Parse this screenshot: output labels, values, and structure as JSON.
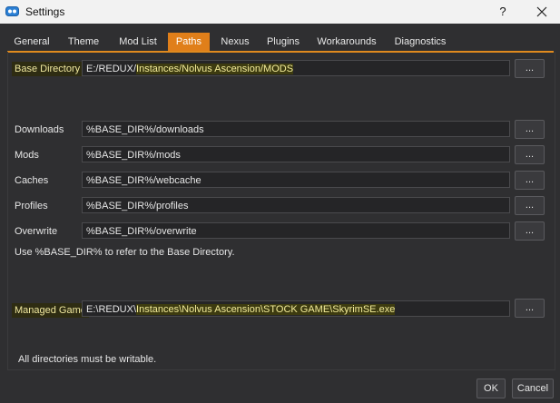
{
  "window": {
    "title": "Settings",
    "help_label": "?",
    "app_icon": "mo2-icon",
    "close_icon": "close-icon"
  },
  "tabs": [
    {
      "label": "General",
      "active": false
    },
    {
      "label": "Theme",
      "active": false
    },
    {
      "label": "Mod List",
      "active": false
    },
    {
      "label": "Paths",
      "active": true
    },
    {
      "label": "Nexus",
      "active": false
    },
    {
      "label": "Plugins",
      "active": false
    },
    {
      "label": "Workarounds",
      "active": false
    },
    {
      "label": "Diagnostics",
      "active": false
    }
  ],
  "paths": {
    "base_directory": {
      "label": "Base Directory",
      "value_prefix": "E:/REDUX/",
      "value_highlight": "Instances/Nolvus Ascension/MODS"
    },
    "downloads": {
      "label": "Downloads",
      "value": "%BASE_DIR%/downloads"
    },
    "mods": {
      "label": "Mods",
      "value": "%BASE_DIR%/mods"
    },
    "caches": {
      "label": "Caches",
      "value": "%BASE_DIR%/webcache"
    },
    "profiles": {
      "label": "Profiles",
      "value": "%BASE_DIR%/profiles"
    },
    "overwrite": {
      "label": "Overwrite",
      "value": "%BASE_DIR%/overwrite"
    },
    "hint": "Use %BASE_DIR% to refer to the Base Directory.",
    "managed_game": {
      "label": "Managed Game",
      "value_prefix": "E:\\REDUX\\",
      "value_highlight": "Instances\\Nolvus Ascension\\STOCK GAME\\SkyrimSE.exe"
    },
    "footer_note": "All directories must be writable.",
    "browse_label": "..."
  },
  "buttons": {
    "ok": "OK",
    "cancel": "Cancel"
  },
  "colors": {
    "accent": "#e07f1a",
    "highlight": "#f3ec9a",
    "background": "#2f2f31"
  }
}
